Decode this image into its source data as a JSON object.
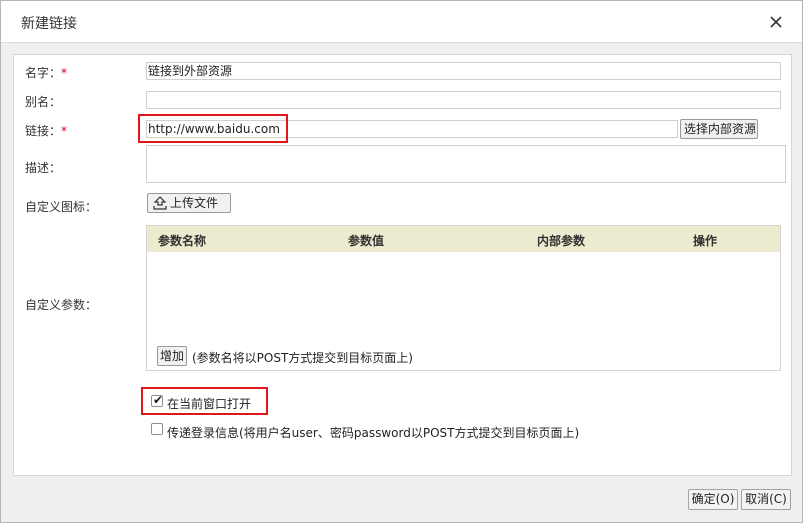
{
  "dialog": {
    "title": "新建链接",
    "close_symbol": "✕"
  },
  "form": {
    "name_label": "名字：",
    "name_required": "*",
    "name_value": "链接到外部资源",
    "alias_label": "别名：",
    "alias_value": "",
    "link_label": "链接：",
    "link_required": "*",
    "link_value": "http://www.baidu.com",
    "choose_internal_button": "选择内部资源",
    "desc_label": "描述：",
    "custom_icon_label": "自定义图标：",
    "upload_button": "上传文件",
    "custom_params_label": "自定义参数：",
    "params_table": {
      "columns": [
        "参数名称",
        "参数值",
        "内部参数",
        "操作"
      ],
      "rows": []
    },
    "add_button": "增加",
    "add_hint": "(参数名将以POST方式提交到目标页面上)",
    "open_current_window_label": "在当前窗口打开",
    "open_current_window_checked": true,
    "pass_login_label": "传递登录信息(将用户名user、密码password以POST方式提交到目标页面上)",
    "pass_login_checked": false
  },
  "footer": {
    "ok_button": "确定(O)",
    "cancel_button": "取消(C)"
  },
  "colors": {
    "highlight_border": "#e0161b",
    "table_header_bg": "#ecebd0",
    "required_star": "#d9001b"
  }
}
